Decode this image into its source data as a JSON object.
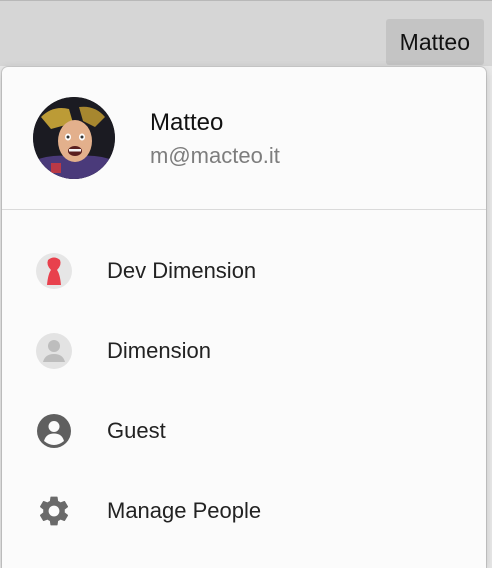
{
  "titlebar": {
    "profile_button_label": "Matteo"
  },
  "profile": {
    "name": "Matteo",
    "email": "m@macteo.it",
    "avatar_icon": "user-photo-avatar"
  },
  "menu": {
    "items": [
      {
        "label": "Dev Dimension",
        "icon": "red-person-avatar-icon",
        "accent": "#e8414d"
      },
      {
        "label": "Dimension",
        "icon": "gray-person-avatar-icon",
        "accent": "#cfcfcf"
      },
      {
        "label": "Guest",
        "icon": "guest-account-icon",
        "accent": "#5f5f5f"
      },
      {
        "label": "Manage People",
        "icon": "gear-icon",
        "accent": "#6a6a6a"
      }
    ]
  }
}
